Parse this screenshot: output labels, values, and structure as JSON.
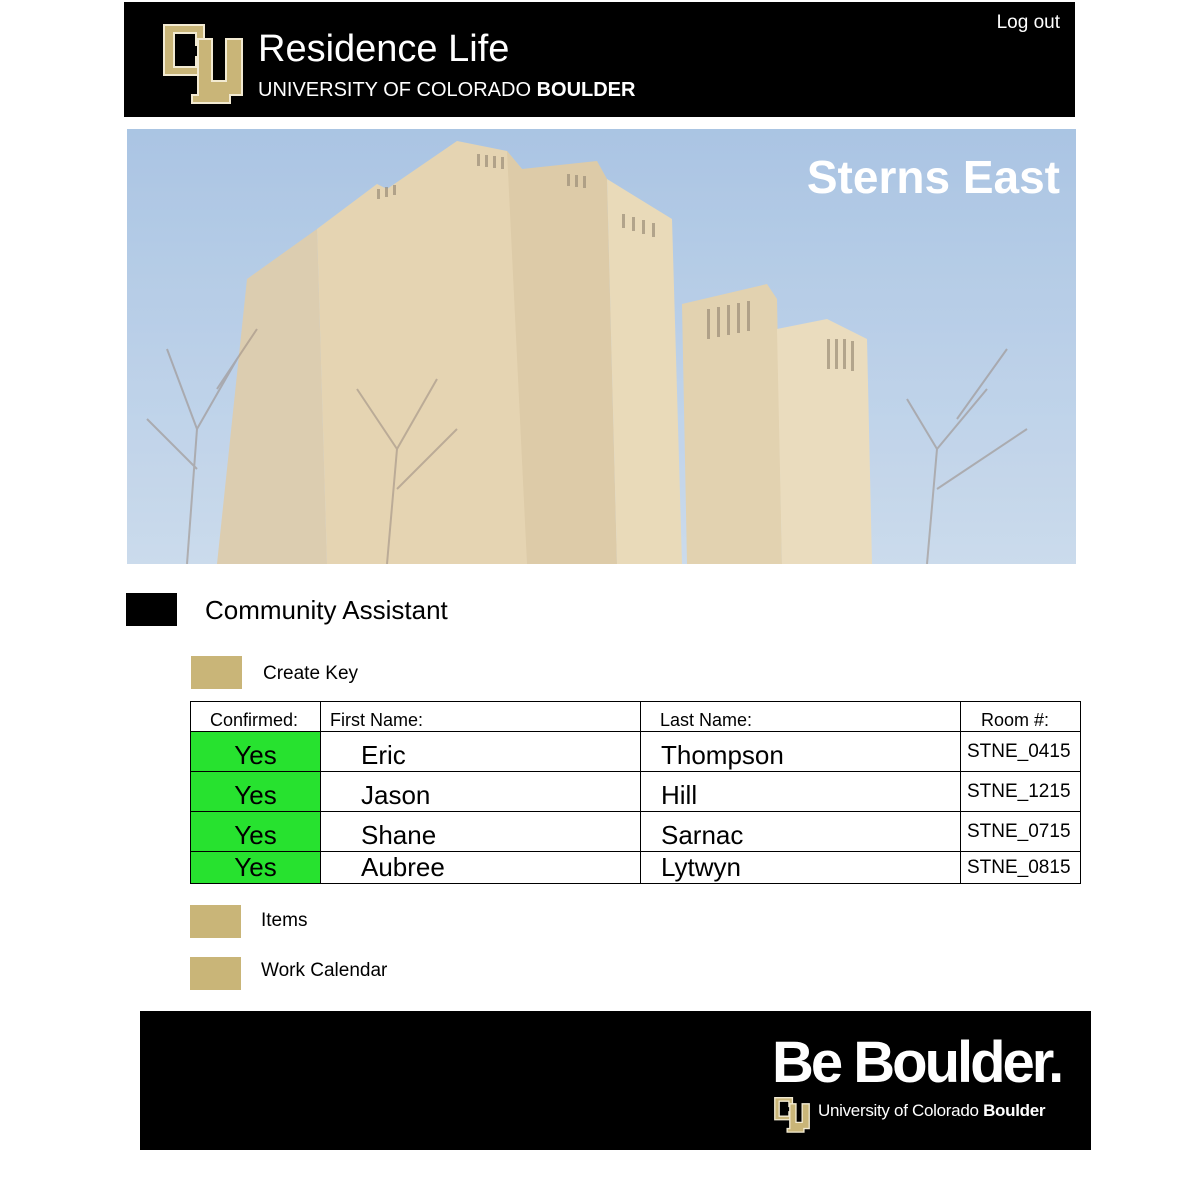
{
  "header": {
    "logo_icon": "cu-logo-icon",
    "title": "Residence Life",
    "subtitle_prefix": "UNIVERSITY OF COLORADO ",
    "subtitle_bold": "BOULDER",
    "logout_label": "Log out"
  },
  "hero": {
    "building_name": "Sterns East",
    "image": "residence-hall-photo"
  },
  "community_assistant": {
    "label": "Community Assistant"
  },
  "create_key": {
    "label": "Create Key"
  },
  "table": {
    "headers": [
      "Confirmed:",
      "First Name:",
      "Last Name:",
      "Room #:"
    ],
    "rows": [
      {
        "confirmed": "Yes",
        "first": "Eric",
        "last": "Thompson",
        "room": "STNE_0415"
      },
      {
        "confirmed": "Yes",
        "first": "Jason",
        "last": "Hill",
        "room": "STNE_1215"
      },
      {
        "confirmed": "Yes",
        "first": "Shane",
        "last": "Sarnac",
        "room": "STNE_0715"
      },
      {
        "confirmed": "Yes",
        "first": "Aubree",
        "last": "Lytwyn",
        "room": "STNE_0815"
      }
    ],
    "confirmed_color": "#27e22f"
  },
  "items": {
    "label": "Items"
  },
  "work_calendar": {
    "label": "Work Calendar"
  },
  "footer": {
    "slogan": "Be Boulder.",
    "univ_prefix": "University of Colorado ",
    "univ_bold": "Boulder"
  },
  "colors": {
    "gold": "#c9b578",
    "black": "#000000",
    "green": "#27e22f"
  }
}
